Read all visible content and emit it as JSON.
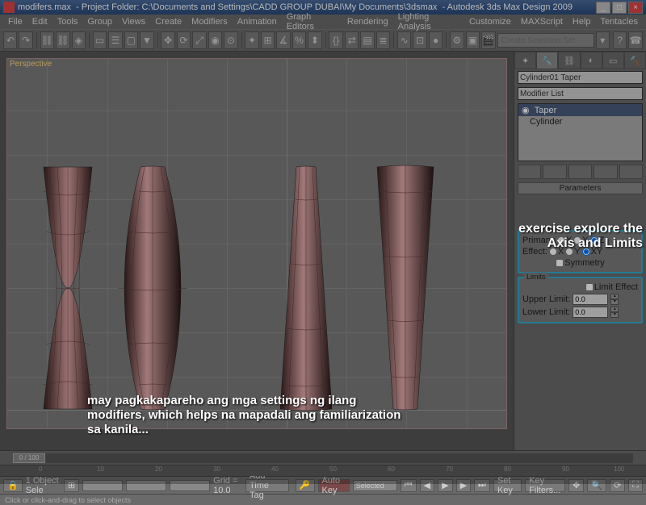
{
  "title": {
    "file": "modifers.max",
    "project": "- Project Folder: C:\\Documents and Settings\\CADD GROUP DUBAI\\My Documents\\3dsmax",
    "app": "- Autodesk 3ds Max Design 2009"
  },
  "menus": [
    "File",
    "Edit",
    "Tools",
    "Group",
    "Views",
    "Create",
    "Modifiers",
    "Animation",
    "Graph Editors",
    "Rendering",
    "Lighting Analysis",
    "Customize",
    "MAXScript",
    "Help",
    "Tentacles"
  ],
  "toolbar": {
    "selset_placeholder": "Create Selection Set"
  },
  "viewport": {
    "label": "Perspective"
  },
  "cmdpanel": {
    "object_name": "Cylinder01 Taper",
    "modlist_placeholder": "Modifier List",
    "stack": {
      "selected": "Taper",
      "base": "Cylinder"
    },
    "rollout_params": "Parameters",
    "taper_axis": {
      "title": "Taper Axis:",
      "primary_label": "Primary:",
      "effect_label": "Effect:",
      "opts": [
        "X",
        "Y",
        "Z"
      ],
      "effect_opts": [
        "X",
        "Y",
        "XY"
      ],
      "symmetry": "Symmetry"
    },
    "limits": {
      "title": "Limits",
      "limit_effect": "Limit Effect",
      "upper_label": "Upper Limit:",
      "upper_val": "0.0",
      "lower_label": "Lower Limit:",
      "lower_val": "0.0"
    }
  },
  "timeline": {
    "frame": "0 / 100",
    "ticks": [
      "0",
      "10",
      "20",
      "30",
      "40",
      "50",
      "60",
      "70",
      "80",
      "90",
      "100"
    ]
  },
  "status": {
    "sel": "1 Object Sele",
    "xyz": "",
    "grid": "Grid = 10.0",
    "autokey": "Auto Key",
    "setkey": "Set Key",
    "selected": "Selected",
    "keyfilters": "Key Filters...",
    "addtimetag": "Add Time Tag"
  },
  "prompt": "Click or click-and-drag to select objects",
  "overlay": {
    "exercise": "exercise explore the Axis and Limits",
    "note": "may pagkakapareho ang mga settings ng ilang modifiers, which helps na mapadali ang familiarization sa kanila..."
  }
}
